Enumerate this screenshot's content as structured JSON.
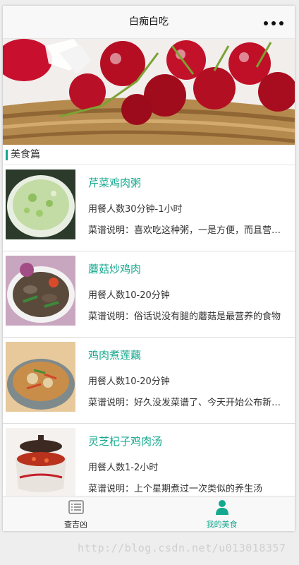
{
  "navbar": {
    "title": "白痴白吃"
  },
  "section": {
    "title": "美食篇"
  },
  "recipes": [
    {
      "title": "芹菜鸡肉粥",
      "time": "用餐人数30分钟-1小时",
      "description": "菜谱说明：喜欢吃这种粥，一是方便，而且营养丰富"
    },
    {
      "title": "蘑菇炒鸡肉",
      "time": "用餐人数10-20分钟",
      "description": "菜谱说明：俗话说没有腿的蘑菇是最营养的食物"
    },
    {
      "title": "鸡肉煮莲藕",
      "time": "用餐人数10-20分钟",
      "description": "菜谱说明：好久没发菜谱了、今天开始公布新菜谱"
    },
    {
      "title": "灵芝杞子鸡肉汤",
      "time": "用餐人数1-2小时",
      "description": "菜谱说明：上个星期煮过一次类似的养生汤"
    }
  ],
  "tabbar": {
    "tabs": [
      {
        "label": "查吉凶",
        "icon": "list-icon",
        "color": "#222222"
      },
      {
        "label": "我的美食",
        "icon": "user-icon",
        "color": "#14a88e"
      }
    ]
  },
  "watermark": "http://blog.csdn.net/u013018357",
  "colors": {
    "accent": "#14a88e",
    "text": "#333333"
  }
}
